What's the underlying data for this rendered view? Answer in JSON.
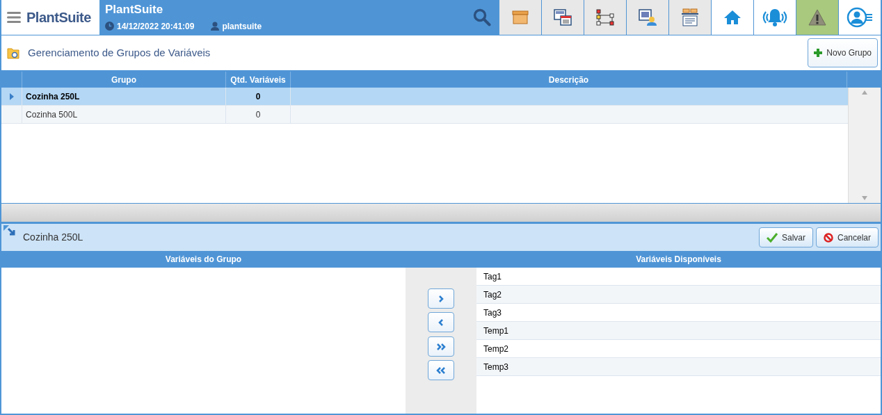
{
  "app": {
    "logo": "PlantSuite",
    "title": "PlantSuite",
    "datetime": "14/12/2022 20:41:09",
    "user": "plantsuite"
  },
  "page": {
    "title": "Gerenciamento de Grupos de Variáveis",
    "new_button": "Novo Grupo"
  },
  "table": {
    "columns": [
      "Grupo",
      "Qtd. Variáveis",
      "Descrição"
    ],
    "rows": [
      {
        "grupo": "Cozinha 250L",
        "qtd": "0",
        "selected": true
      },
      {
        "grupo": "Cozinha 500L",
        "qtd": "0",
        "selected": false
      }
    ]
  },
  "detail": {
    "title": "Cozinha 250L",
    "save_button": "Salvar",
    "cancel_button": "Cancelar",
    "group_header": "Variáveis do Grupo",
    "available_header": "Variáveis Disponíveis",
    "available": [
      "Tag1",
      "Tag2",
      "Tag3",
      "Temp1",
      "Temp2",
      "Temp3"
    ]
  }
}
